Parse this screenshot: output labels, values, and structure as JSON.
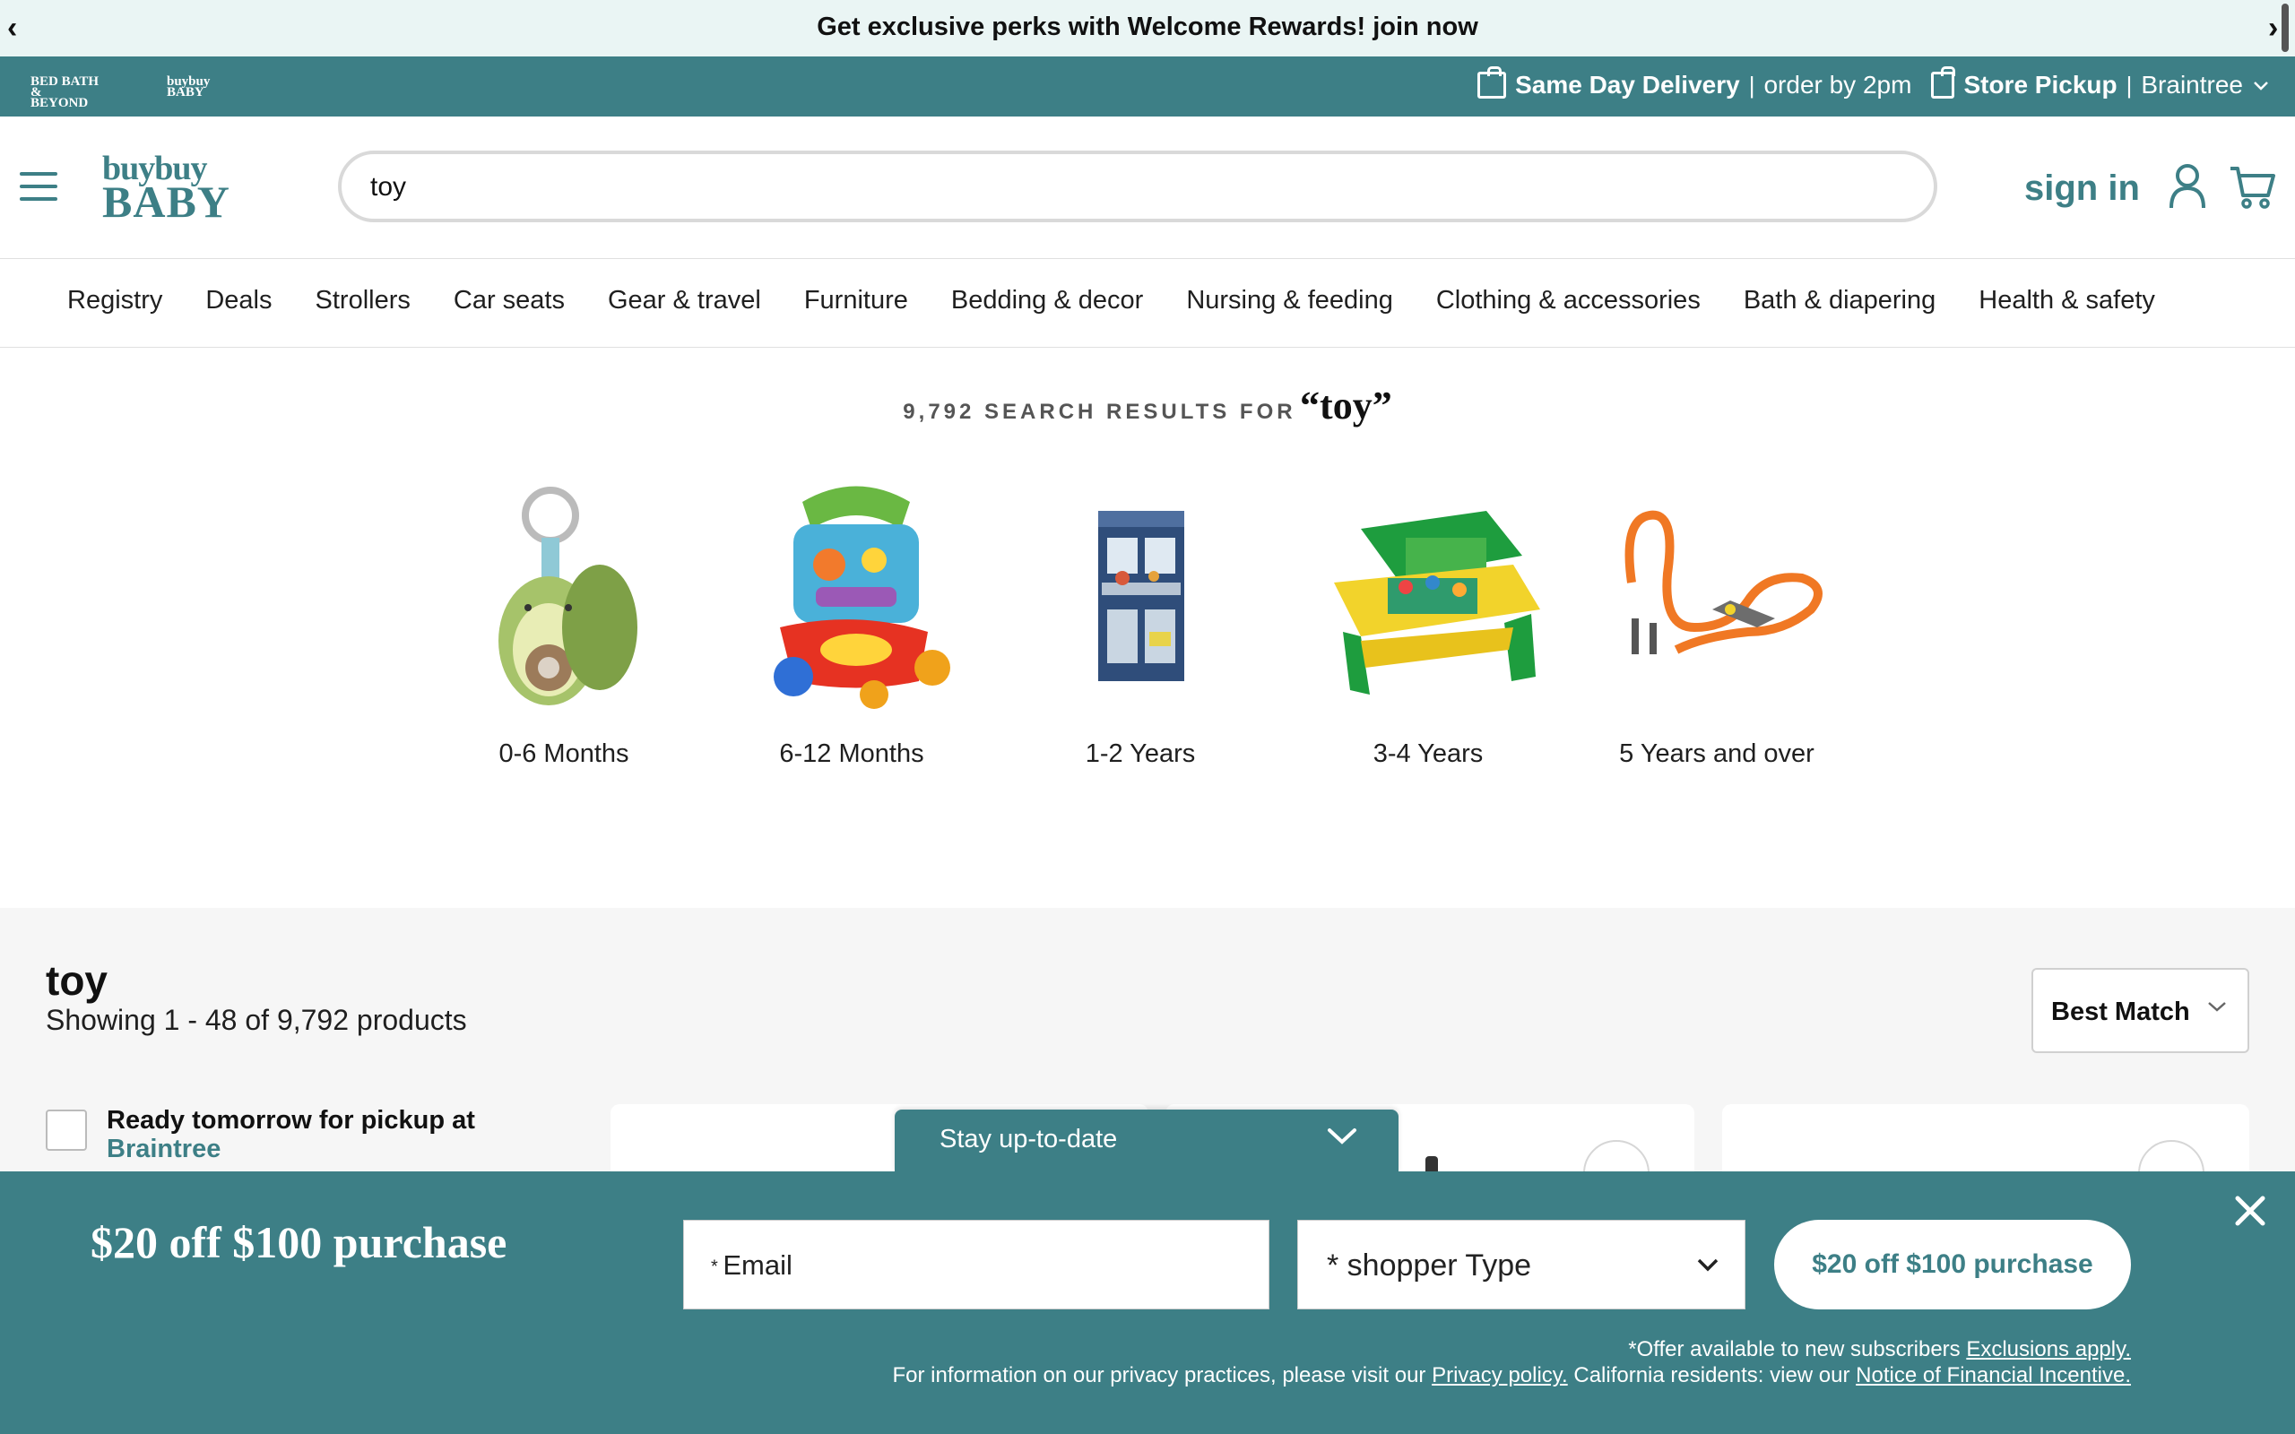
{
  "promo": {
    "text": "Get exclusive perks with Welcome Rewards! join now",
    "prev": "‹",
    "next": "›"
  },
  "brand_strip": {
    "bbb_logo": "BED BATH & BEYOND",
    "bb_logo": "buybuy BABY",
    "same_day": "Same Day Delivery",
    "same_day_note": "order by 2pm",
    "store_pickup": "Store Pickup",
    "store_name": "Braintree"
  },
  "header": {
    "logo_line1": "buybuy",
    "logo_line2": "BABY",
    "search_value": "toy",
    "sign_in": "sign in"
  },
  "nav": [
    "Registry",
    "Deals",
    "Strollers",
    "Car seats",
    "Gear & travel",
    "Furniture",
    "Bedding & decor",
    "Nursing & feeding",
    "Clothing & accessories",
    "Bath & diapering",
    "Health & safety"
  ],
  "results": {
    "count_text": "9,792 search results for",
    "term": "“toy”"
  },
  "age_categories": [
    "0-6 Months",
    "6-12 Months",
    "1-2 Years",
    "3-4 Years",
    "5 Years and over"
  ],
  "listing": {
    "title": "toy",
    "showing": "Showing 1 - 48 of 9,792 products",
    "sort": "Best Match",
    "filter_line1": "Ready tomorrow for pickup at",
    "filter_line2": "Braintree"
  },
  "stay": {
    "label": "Stay up-to-date"
  },
  "offer": {
    "title": "$20 off $100 purchase",
    "email_placeholder": "Email",
    "shopper_type": "* shopper Type",
    "button": "$20 off $100 purchase",
    "fine1_text": "*Offer available to new subscribers",
    "fine1_link": "Exclusions apply.",
    "fine2_text": "For information on our privacy practices, please visit our",
    "fine2_link1": "Privacy policy.",
    "fine2_mid": "California residents: view our",
    "fine2_link2": "Notice of Financial Incentive."
  },
  "colors": {
    "brand_teal": "#3d7f86",
    "promo_bg": "#eaf5f4",
    "page_gray": "#f6f6f6"
  }
}
